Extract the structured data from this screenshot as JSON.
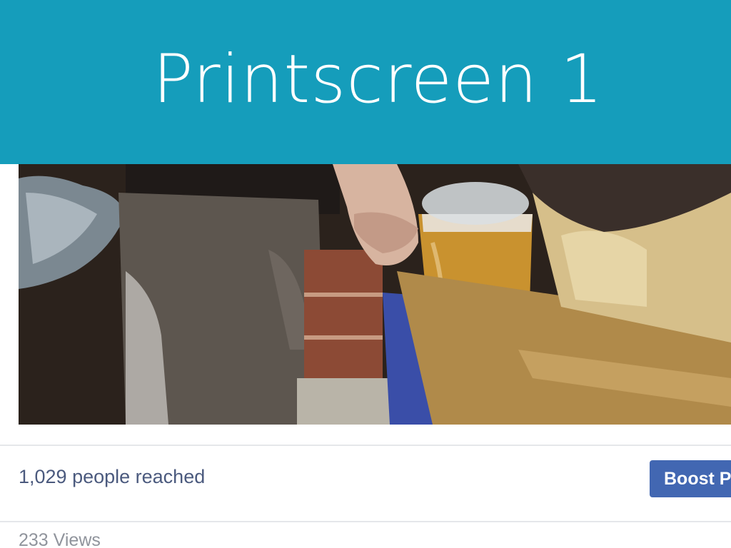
{
  "slide": {
    "title": "Printscreen 1",
    "banner_color": "#159dbb"
  },
  "post": {
    "video_icon": "video-thumbnail-image",
    "reach_text": "1,029 people reached",
    "boost_button_label": "Boost P",
    "views_text": "233 Views",
    "colors": {
      "reach_text": "#4b5a7e",
      "boost_button": "#4267b2",
      "views_text": "#90949c"
    }
  }
}
